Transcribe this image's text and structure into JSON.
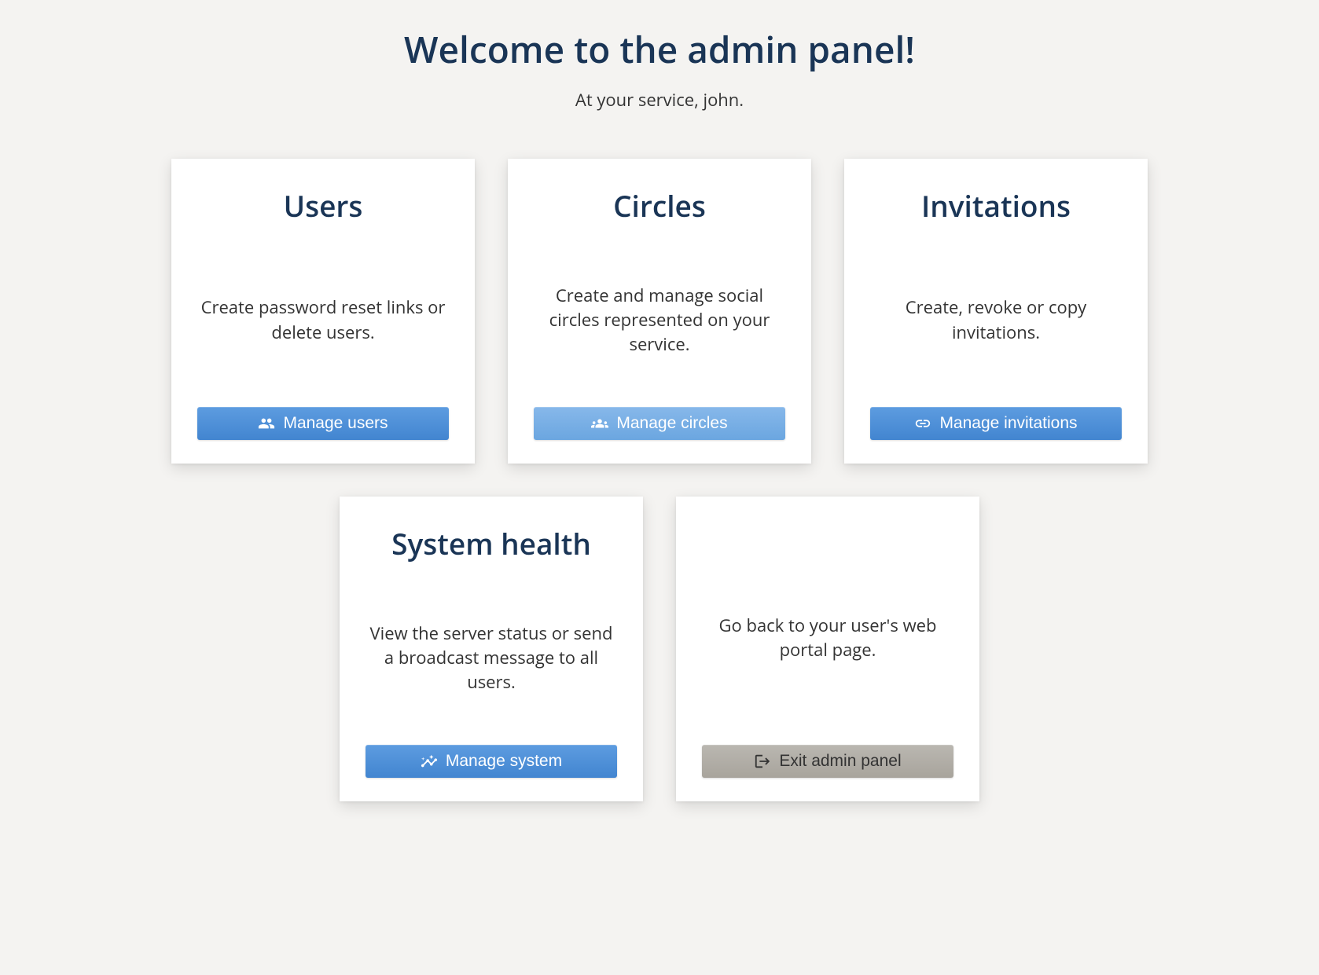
{
  "header": {
    "title": "Welcome to the admin panel!",
    "subtitle": "At your service, john."
  },
  "cards": {
    "users": {
      "title": "Users",
      "description": "Create password reset links or delete users.",
      "button_label": "Manage users"
    },
    "circles": {
      "title": "Circles",
      "description": "Create and manage social circles represented on your service.",
      "button_label": "Manage circles"
    },
    "invitations": {
      "title": "Invitations",
      "description": "Create, revoke or copy invitations.",
      "button_label": "Manage invitations"
    },
    "system_health": {
      "title": "System health",
      "description": "View the server status or send a broadcast message to all users.",
      "button_label": "Manage system"
    },
    "exit": {
      "title": "",
      "description": "Go back to your user's web portal page.",
      "button_label": "Exit admin panel"
    }
  }
}
